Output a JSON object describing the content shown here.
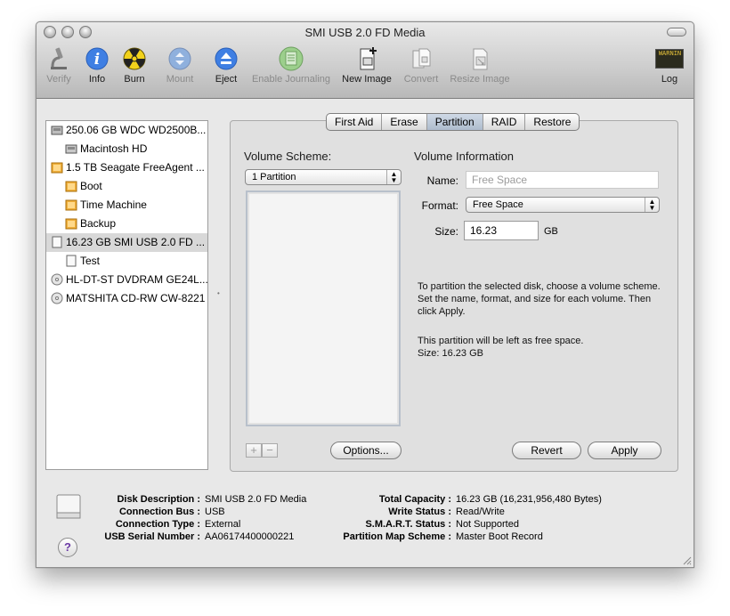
{
  "window": {
    "title": "SMI USB 2.0 FD Media"
  },
  "toolbar": {
    "items": [
      {
        "label": "Verify",
        "icon": "microscope-icon",
        "enabled": false
      },
      {
        "label": "Info",
        "icon": "info-icon",
        "enabled": true
      },
      {
        "label": "Burn",
        "icon": "burn-icon",
        "enabled": true
      },
      {
        "label": "Mount",
        "icon": "mount-icon",
        "enabled": false
      },
      {
        "label": "Eject",
        "icon": "eject-icon",
        "enabled": true
      },
      {
        "label": "Enable Journaling",
        "icon": "journal-icon",
        "enabled": false
      },
      {
        "label": "New Image",
        "icon": "new-image-icon",
        "enabled": true
      },
      {
        "label": "Convert",
        "icon": "convert-icon",
        "enabled": false
      },
      {
        "label": "Resize Image",
        "icon": "resize-image-icon",
        "enabled": false
      },
      {
        "label": "Log",
        "icon": "log-icon",
        "enabled": true
      }
    ],
    "log_badge": "WARNIN"
  },
  "sidebar": {
    "items": [
      {
        "label": "250.06 GB WDC WD2500B...",
        "icon": "hard-disk-icon",
        "level": 0,
        "selected": false
      },
      {
        "label": "Macintosh HD",
        "icon": "volume-icon",
        "level": 1,
        "selected": false
      },
      {
        "label": "1.5 TB Seagate FreeAgent ...",
        "icon": "external-disk-icon",
        "level": 0,
        "selected": false
      },
      {
        "label": "Boot",
        "icon": "external-volume-icon",
        "level": 1,
        "selected": false
      },
      {
        "label": "Time Machine",
        "icon": "external-volume-icon",
        "level": 1,
        "selected": false
      },
      {
        "label": "Backup",
        "icon": "external-volume-icon",
        "level": 1,
        "selected": false
      },
      {
        "label": "16.23 GB SMI USB 2.0 FD ...",
        "icon": "usb-disk-icon",
        "level": 0,
        "selected": true
      },
      {
        "label": "Test",
        "icon": "usb-volume-icon",
        "level": 1,
        "selected": false
      },
      {
        "label": "HL-DT-ST DVDRAM GE24L...",
        "icon": "optical-drive-icon",
        "level": 0,
        "selected": false
      },
      {
        "label": "MATSHITA CD-RW CW-8221",
        "icon": "optical-drive-icon",
        "level": 0,
        "selected": false
      }
    ]
  },
  "tabs": [
    {
      "label": "First Aid",
      "active": false
    },
    {
      "label": "Erase",
      "active": false
    },
    {
      "label": "Partition",
      "active": true
    },
    {
      "label": "RAID",
      "active": false
    },
    {
      "label": "Restore",
      "active": false
    }
  ],
  "partition": {
    "scheme_title": "Volume Scheme:",
    "scheme_value": "1 Partition",
    "info_title": "Volume Information",
    "name_label": "Name:",
    "name_placeholder": "Free Space",
    "format_label": "Format:",
    "format_value": "Free Space",
    "size_label": "Size:",
    "size_value": "16.23",
    "size_unit": "GB",
    "help_text": "To partition the selected disk, choose a volume scheme. Set the name, format, and size for each volume. Then click Apply.",
    "status_line1": "This partition will be left as free space.",
    "status_line2": "Size: 16.23 GB",
    "add_label": "+",
    "remove_label": "−",
    "options_label": "Options...",
    "revert_label": "Revert",
    "apply_label": "Apply"
  },
  "disk_info": {
    "left": [
      {
        "label": "Disk Description :",
        "value": "SMI USB 2.0 FD Media"
      },
      {
        "label": "Connection Bus :",
        "value": "USB"
      },
      {
        "label": "Connection Type :",
        "value": "External"
      },
      {
        "label": "USB Serial Number :",
        "value": "AA06174400000221"
      }
    ],
    "right": [
      {
        "label": "Total Capacity :",
        "value": "16.23 GB (16,231,956,480 Bytes)"
      },
      {
        "label": "Write Status :",
        "value": "Read/Write"
      },
      {
        "label": "S.M.A.R.T. Status :",
        "value": "Not Supported"
      },
      {
        "label": "Partition Map Scheme :",
        "value": "Master Boot Record"
      }
    ],
    "help_label": "?"
  }
}
